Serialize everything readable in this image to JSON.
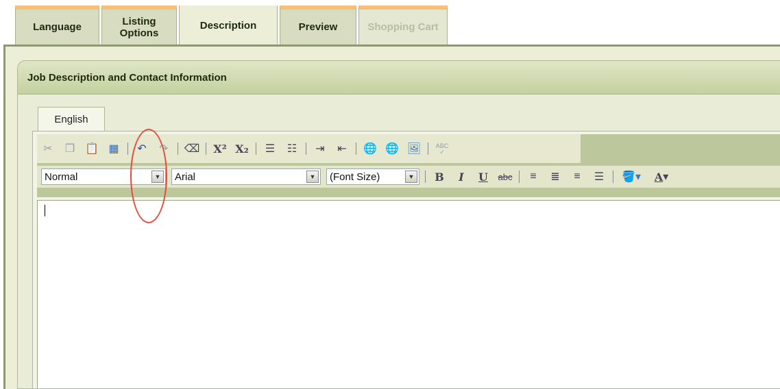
{
  "tabs": [
    {
      "label": "Language",
      "state": "normal"
    },
    {
      "label": "Listing Options",
      "state": "normal"
    },
    {
      "label": "Description",
      "state": "active"
    },
    {
      "label": "Preview",
      "state": "normal"
    },
    {
      "label": "Shopping Cart",
      "state": "disabled"
    }
  ],
  "panel": {
    "title": "Job Description and Contact Information",
    "language_tab": "English"
  },
  "toolbar": {
    "format_value": "Normal",
    "font_value": "Arial",
    "size_value": "(Font Size)",
    "bold": "B",
    "italic": "I",
    "underline": "U",
    "strike": "abc",
    "font_color": "A",
    "spell": "ABC"
  },
  "colors": {
    "tab_accent": "#f6c07a",
    "panel_border": "#8a9a6a",
    "annotation": "#e24a3c"
  }
}
